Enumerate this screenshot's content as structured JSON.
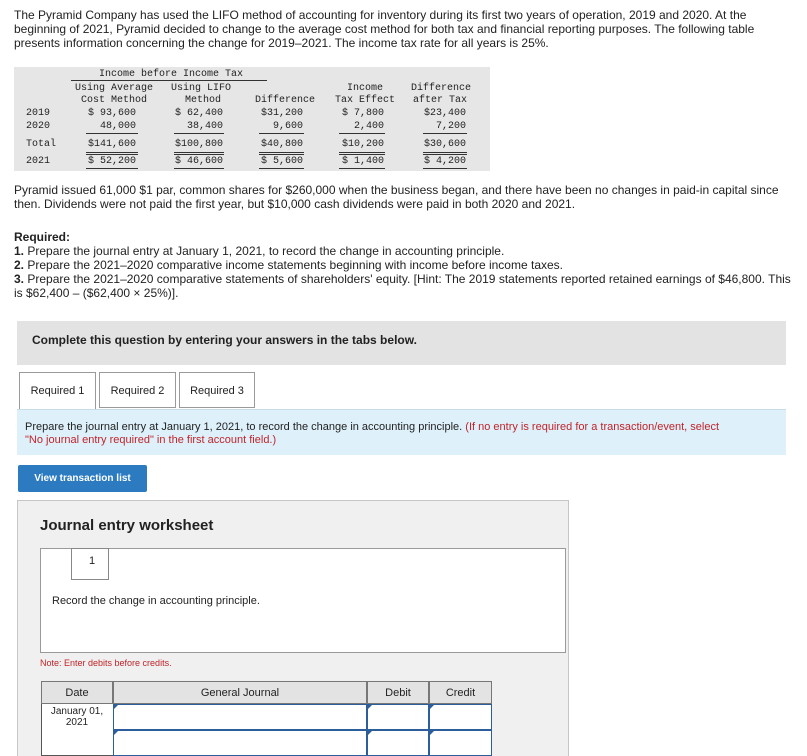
{
  "intro": "The Pyramid Company has used the LIFO method of accounting for inventory during its first two years of operation, 2019 and 2020. At the beginning of 2021, Pyramid decided to change to the average cost method for both tax and financial reporting purposes. The following table presents information concerning the change for 2019–2021. The income tax rate for all years is 25%.",
  "table": {
    "group_header": "Income before Income Tax",
    "col_avg": [
      "Using Average",
      "Cost Method"
    ],
    "col_lifo": [
      "Using LIFO",
      "Method"
    ],
    "col_diff": "Difference",
    "col_tax": [
      "Income",
      "Tax Effect"
    ],
    "col_after": [
      "Difference",
      "after Tax"
    ],
    "rows": [
      {
        "label": "2019",
        "avg": "$ 93,600",
        "lifo": "$ 62,400",
        "diff": "$31,200",
        "tax": "$ 7,800",
        "after": "$23,400"
      },
      {
        "label": "2020",
        "avg": "48,000",
        "lifo": "38,400",
        "diff": "9,600",
        "tax": "2,400",
        "after": "7,200"
      },
      {
        "label": "Total",
        "avg": "$141,600",
        "lifo": "$100,800",
        "diff": "$40,800",
        "tax": "$10,200",
        "after": "$30,600"
      },
      {
        "label": "2021",
        "avg": "$ 52,200",
        "lifo": "$ 46,600",
        "diff": "$ 5,600",
        "tax": "$ 1,400",
        "after": "$ 4,200"
      }
    ]
  },
  "paragraph": "Pyramid issued 61,000 $1 par, common shares for $260,000 when the business began, and there have been no changes in paid-in capital since then. Dividends were not paid the first year, but $10,000 cash dividends were paid in both 2020 and 2021.",
  "required": {
    "heading": "Required:",
    "items": [
      {
        "num": "1.",
        "text": " Prepare the journal entry at January 1, 2021, to record the change in accounting principle."
      },
      {
        "num": "2.",
        "text": " Prepare the 2021–2020 comparative income statements beginning with income before income taxes."
      },
      {
        "num": "3.",
        "text": " Prepare the 2021–2020 comparative statements of shareholders' equity. [Hint: The 2019 statements reported retained earnings of $46,800. This is $62,400 – ($62,400 × 25%)]."
      }
    ]
  },
  "banner": "Complete this question by entering your answers in the tabs below.",
  "tabs": [
    "Required 1",
    "Required 2",
    "Required 3"
  ],
  "instruction": {
    "main": "Prepare the journal entry at January 1, 2021, to record the change in accounting principle.",
    "note": "(If no entry is required for a transaction/event, select \"No journal entry required\" in the first account field.)"
  },
  "view_button": "View transaction list",
  "worksheet": {
    "title": "Journal entry worksheet",
    "page": "1",
    "prev_icon": "chevron-left-icon",
    "next_icon": "chevron-right-icon",
    "entry_description": "Record the change in accounting principle.",
    "note": "Note: Enter debits before credits.",
    "columns": [
      "Date",
      "General Journal",
      "Debit",
      "Credit"
    ],
    "rows": [
      {
        "date": "January 01, 2021",
        "account": "",
        "debit": "",
        "credit": ""
      },
      {
        "date": "",
        "account": "",
        "debit": "",
        "credit": ""
      }
    ]
  },
  "colors": {
    "accent": "#2c7bc1",
    "info_bg": "#def0fa",
    "note_red": "#c0242a",
    "input_border": "#2b5e9a"
  }
}
